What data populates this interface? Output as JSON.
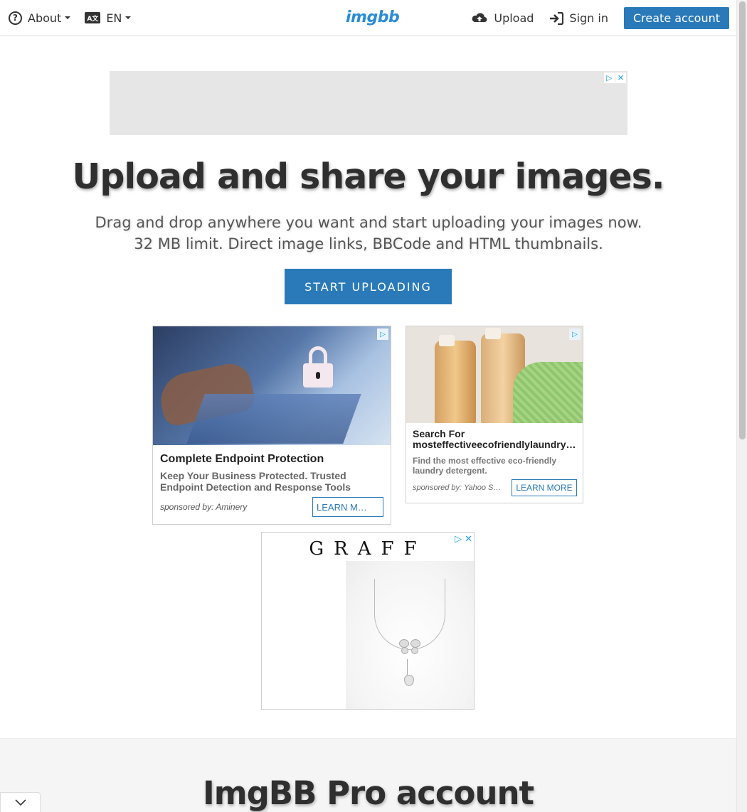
{
  "header": {
    "about_label": "About",
    "language_label": "EN",
    "logo_text": "imgbb",
    "upload_label": "Upload",
    "signin_label": "Sign in",
    "create_account_label": "Create account"
  },
  "hero": {
    "title": "Upload and share your images.",
    "description": "Drag and drop anywhere you want and start uploading your images now. 32 MB limit. Direct image links, BBCode and HTML thumbnails.",
    "start_button": "START UPLOADING"
  },
  "ads": {
    "ad1": {
      "title": "Complete Endpoint Protection",
      "description": "Keep Your Business Protected. Trusted Endpoint Detection and Response Tools",
      "sponsor": "sponsored by: Aminery",
      "button": "LEARN M…"
    },
    "ad2": {
      "title_line1": "Search For",
      "title_line2": "mosteffectiveecofriendlylaundry…",
      "description": "Find the most effective eco-friendly laundry detergent.",
      "sponsor": "sponsored by: Yahoo Se…",
      "button": "LEARN MORE"
    },
    "ad3": {
      "brand": "GRAFF"
    }
  },
  "pro": {
    "title": "ImgBB Pro account"
  },
  "colors": {
    "accent": "#2a7ab9",
    "logo": "#2a8cd6",
    "adchoices": "#1aa0e8"
  },
  "icons": {
    "about": "help-circle-icon",
    "language": "language-icon",
    "upload": "cloud-upload-icon",
    "signin": "sign-in-icon",
    "collapse": "chevron-down-icon"
  }
}
